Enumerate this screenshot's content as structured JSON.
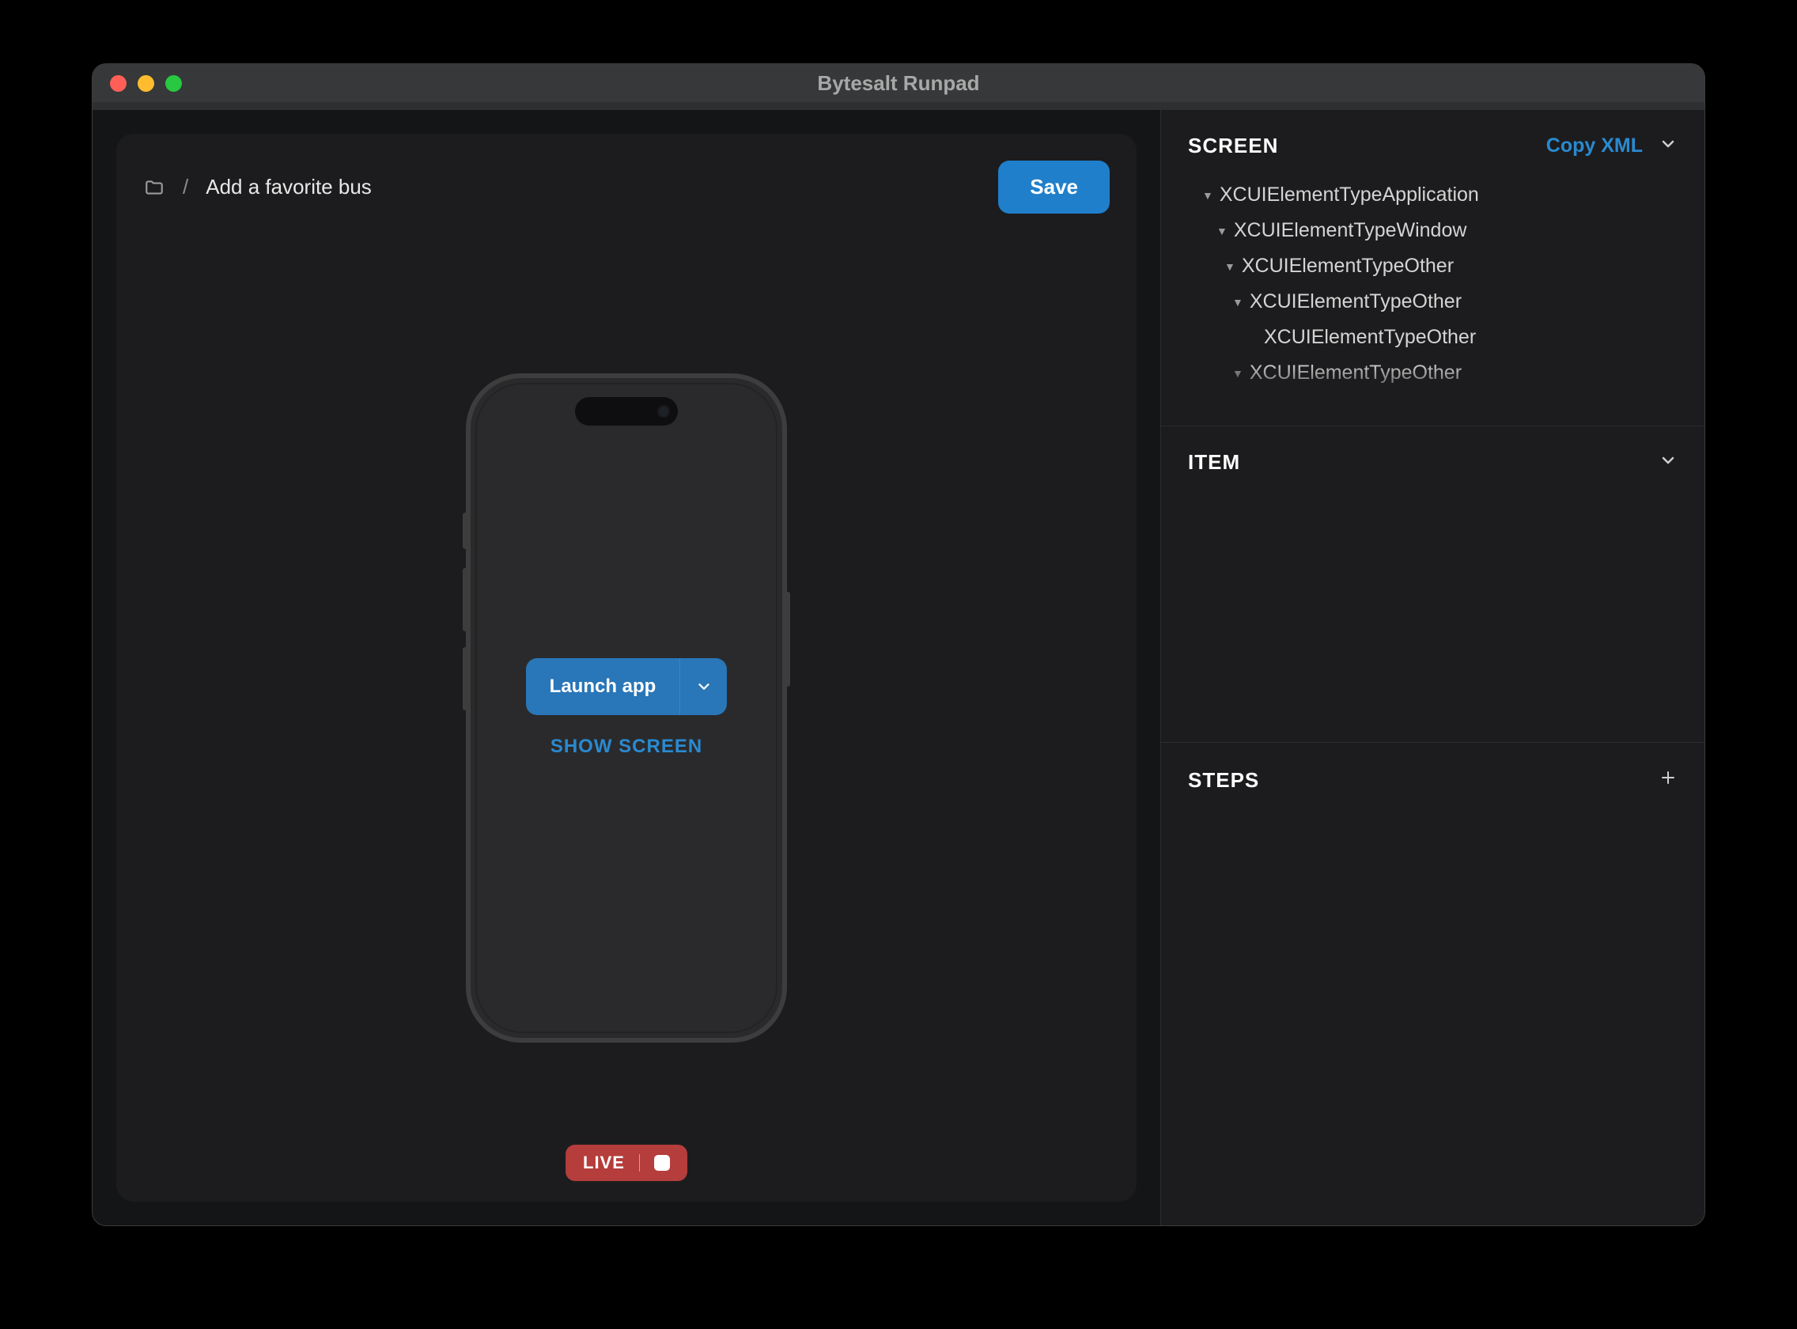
{
  "window": {
    "title": "Bytesalt Runpad"
  },
  "toolbar": {
    "breadcrumb": "/",
    "title": "Add a favorite bus",
    "save_label": "Save"
  },
  "phone": {
    "launch_label": "Launch app",
    "show_screen_label": "SHOW SCREEN",
    "live_label": "LIVE"
  },
  "panels": {
    "screen": {
      "title": "SCREEN",
      "copy_label": "Copy XML"
    },
    "item": {
      "title": "ITEM"
    },
    "steps": {
      "title": "STEPS"
    }
  },
  "tree": [
    {
      "indent": "i1",
      "expanded": true,
      "label": "XCUIElementTypeApplication"
    },
    {
      "indent": "i2",
      "expanded": true,
      "label": "XCUIElementTypeWindow"
    },
    {
      "indent": "i3",
      "expanded": true,
      "label": "XCUIElementTypeOther"
    },
    {
      "indent": "i4",
      "expanded": true,
      "label": "XCUIElementTypeOther"
    },
    {
      "indent": "i5",
      "expanded": null,
      "label": "XCUIElementTypeOther"
    },
    {
      "indent": "i6",
      "expanded": true,
      "label": "XCUIElementTypeOther"
    }
  ]
}
